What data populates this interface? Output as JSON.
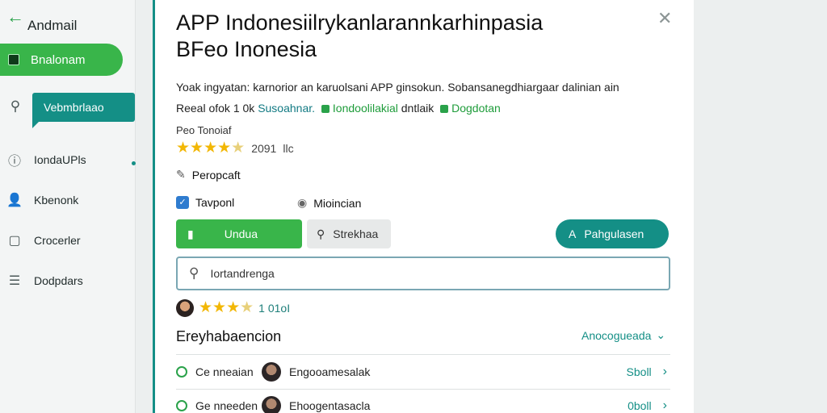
{
  "sidebar": {
    "app_title": "Andmail",
    "primary_label": "Bnalonam",
    "active_label": "Vebmbrlaao",
    "items": [
      {
        "label": "IondaUPls",
        "icon": "info-icon"
      },
      {
        "label": "Kbenonk",
        "icon": "person-icon"
      },
      {
        "label": "Crocerler",
        "icon": "chat-icon"
      },
      {
        "label": "Dodpdars",
        "icon": "list-icon"
      }
    ]
  },
  "panel": {
    "title_line1": "APP Indonesiilrykanlarannkarhinpasia",
    "title_line2": "BFeo Inonesia",
    "desc_line1": "Yoak ingyatan: karnorior an karuolsani APP ginsokun. Sobansanegdhiargaar dalinian ain",
    "desc_prefix": "Reeal ofok 1 0k",
    "link1": "Susoahnar.",
    "link2": "Iondoolilakial",
    "link2_suffix": "dntlaik",
    "link3": "Dogdotan",
    "meta_label": "Peo Tonoiaf",
    "rating_count": "2091",
    "rating_suffix": "llc",
    "feature_label": "Peropcaft",
    "option1": "Tavponl",
    "option2": "Mioincian",
    "btn_primary": "Undua",
    "btn_secondary": "Strekhaa",
    "btn_teal": "Pahgulasen",
    "search_value": "Iortandrenga",
    "review_count": "1 01oI",
    "section_title": "Ereyhabaencion",
    "section_more": "Anocogueada",
    "rows": [
      {
        "label": "Ce nneaian",
        "name": "Engooamesalak",
        "action": "Sboll"
      },
      {
        "label": "Ge nneeden",
        "name": "Ehoogentasacla",
        "action": "0boll"
      }
    ]
  },
  "colors": {
    "accent_green": "#39b54a",
    "accent_teal": "#148f86",
    "star": "#f2b705"
  }
}
